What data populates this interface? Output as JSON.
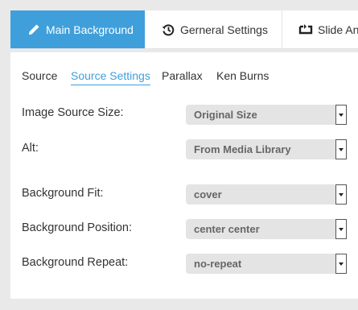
{
  "top_tabs": [
    {
      "label": "Main Background",
      "icon": "pencil-icon"
    },
    {
      "label": "Gerneral Settings",
      "icon": "history-icon"
    },
    {
      "label": "Slide Ani",
      "icon": "transition-icon"
    }
  ],
  "sub_tabs": [
    "Source",
    "Source Settings",
    "Parallax",
    "Ken Burns"
  ],
  "fields": [
    {
      "label": "Image Source Size:",
      "value": "Original Size"
    },
    {
      "label": "Alt:",
      "value": "From Media Library"
    },
    {
      "label": "Background Fit:",
      "value": "cover"
    },
    {
      "label": "Background Position:",
      "value": "center center"
    },
    {
      "label": "Background Repeat:",
      "value": "no-repeat"
    }
  ],
  "colors": {
    "accent": "#3f9fdb",
    "background": "#e9e9e9",
    "select_bg": "#e4e4e4"
  }
}
